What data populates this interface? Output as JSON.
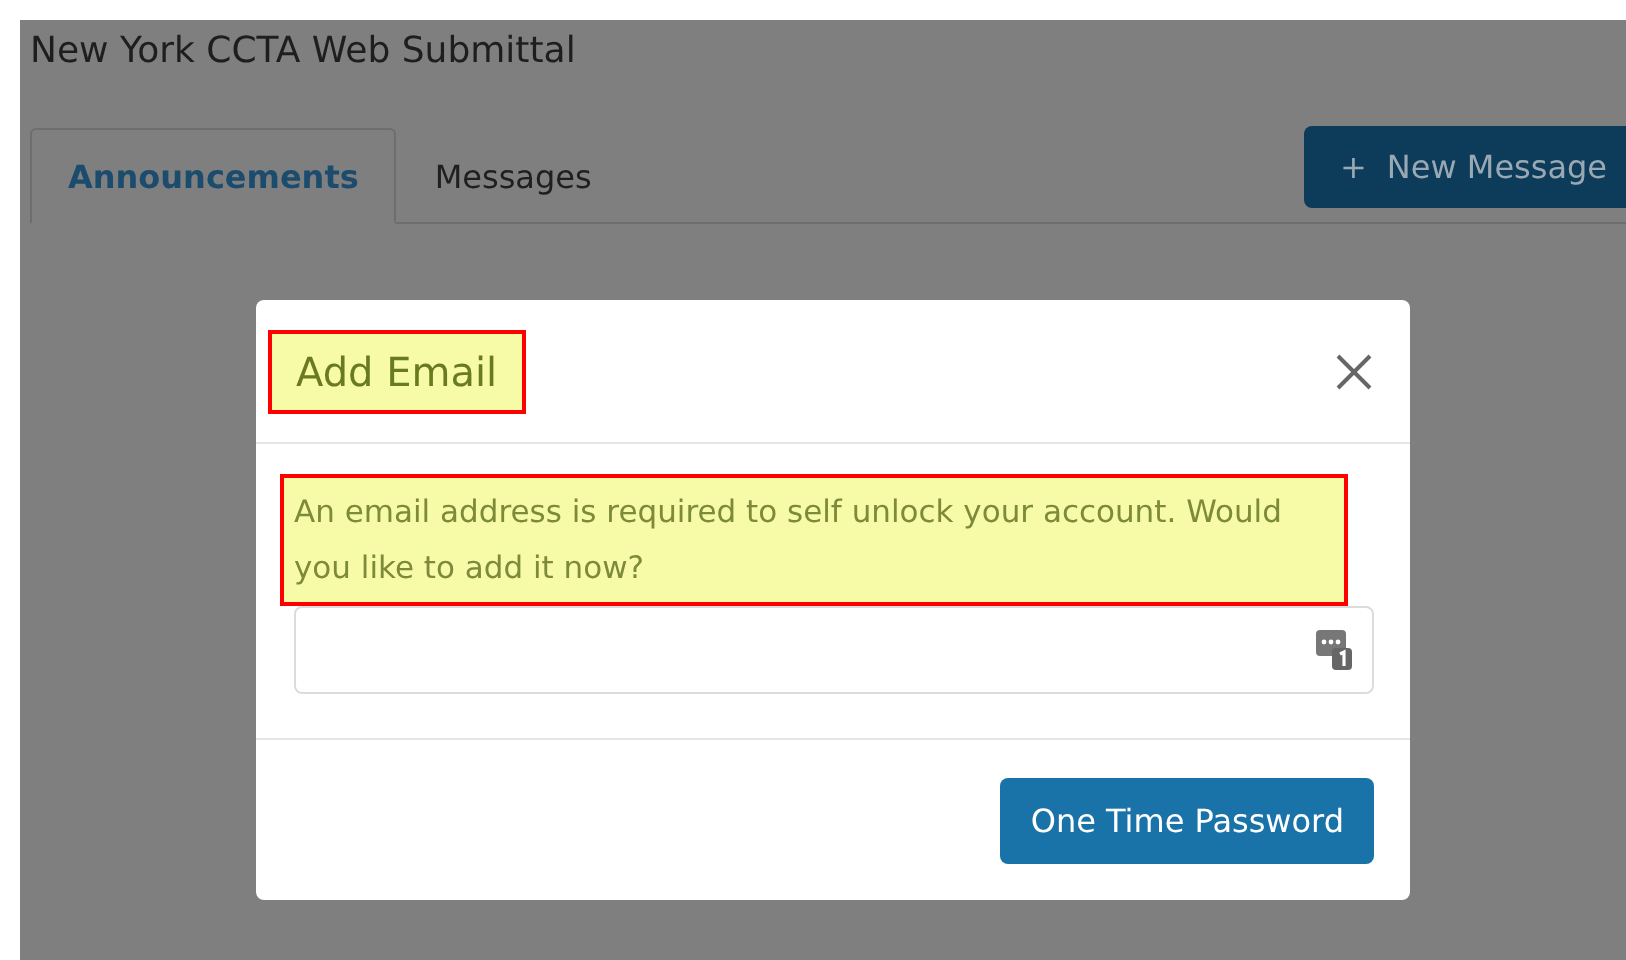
{
  "page": {
    "title": "New York CCTA Web Submittal"
  },
  "tabs": [
    {
      "label": "Announcements",
      "selected": true
    },
    {
      "label": "Messages",
      "selected": false
    }
  ],
  "new_message_button": {
    "icon": "+",
    "label": "New Message"
  },
  "dialog": {
    "title": "Add Email",
    "title_highlighted": true,
    "message": "An email address is required to self unlock your account. Would you like to add it now?",
    "message_highlighted": true,
    "buttons": [
      "One Time Password"
    ]
  }
}
